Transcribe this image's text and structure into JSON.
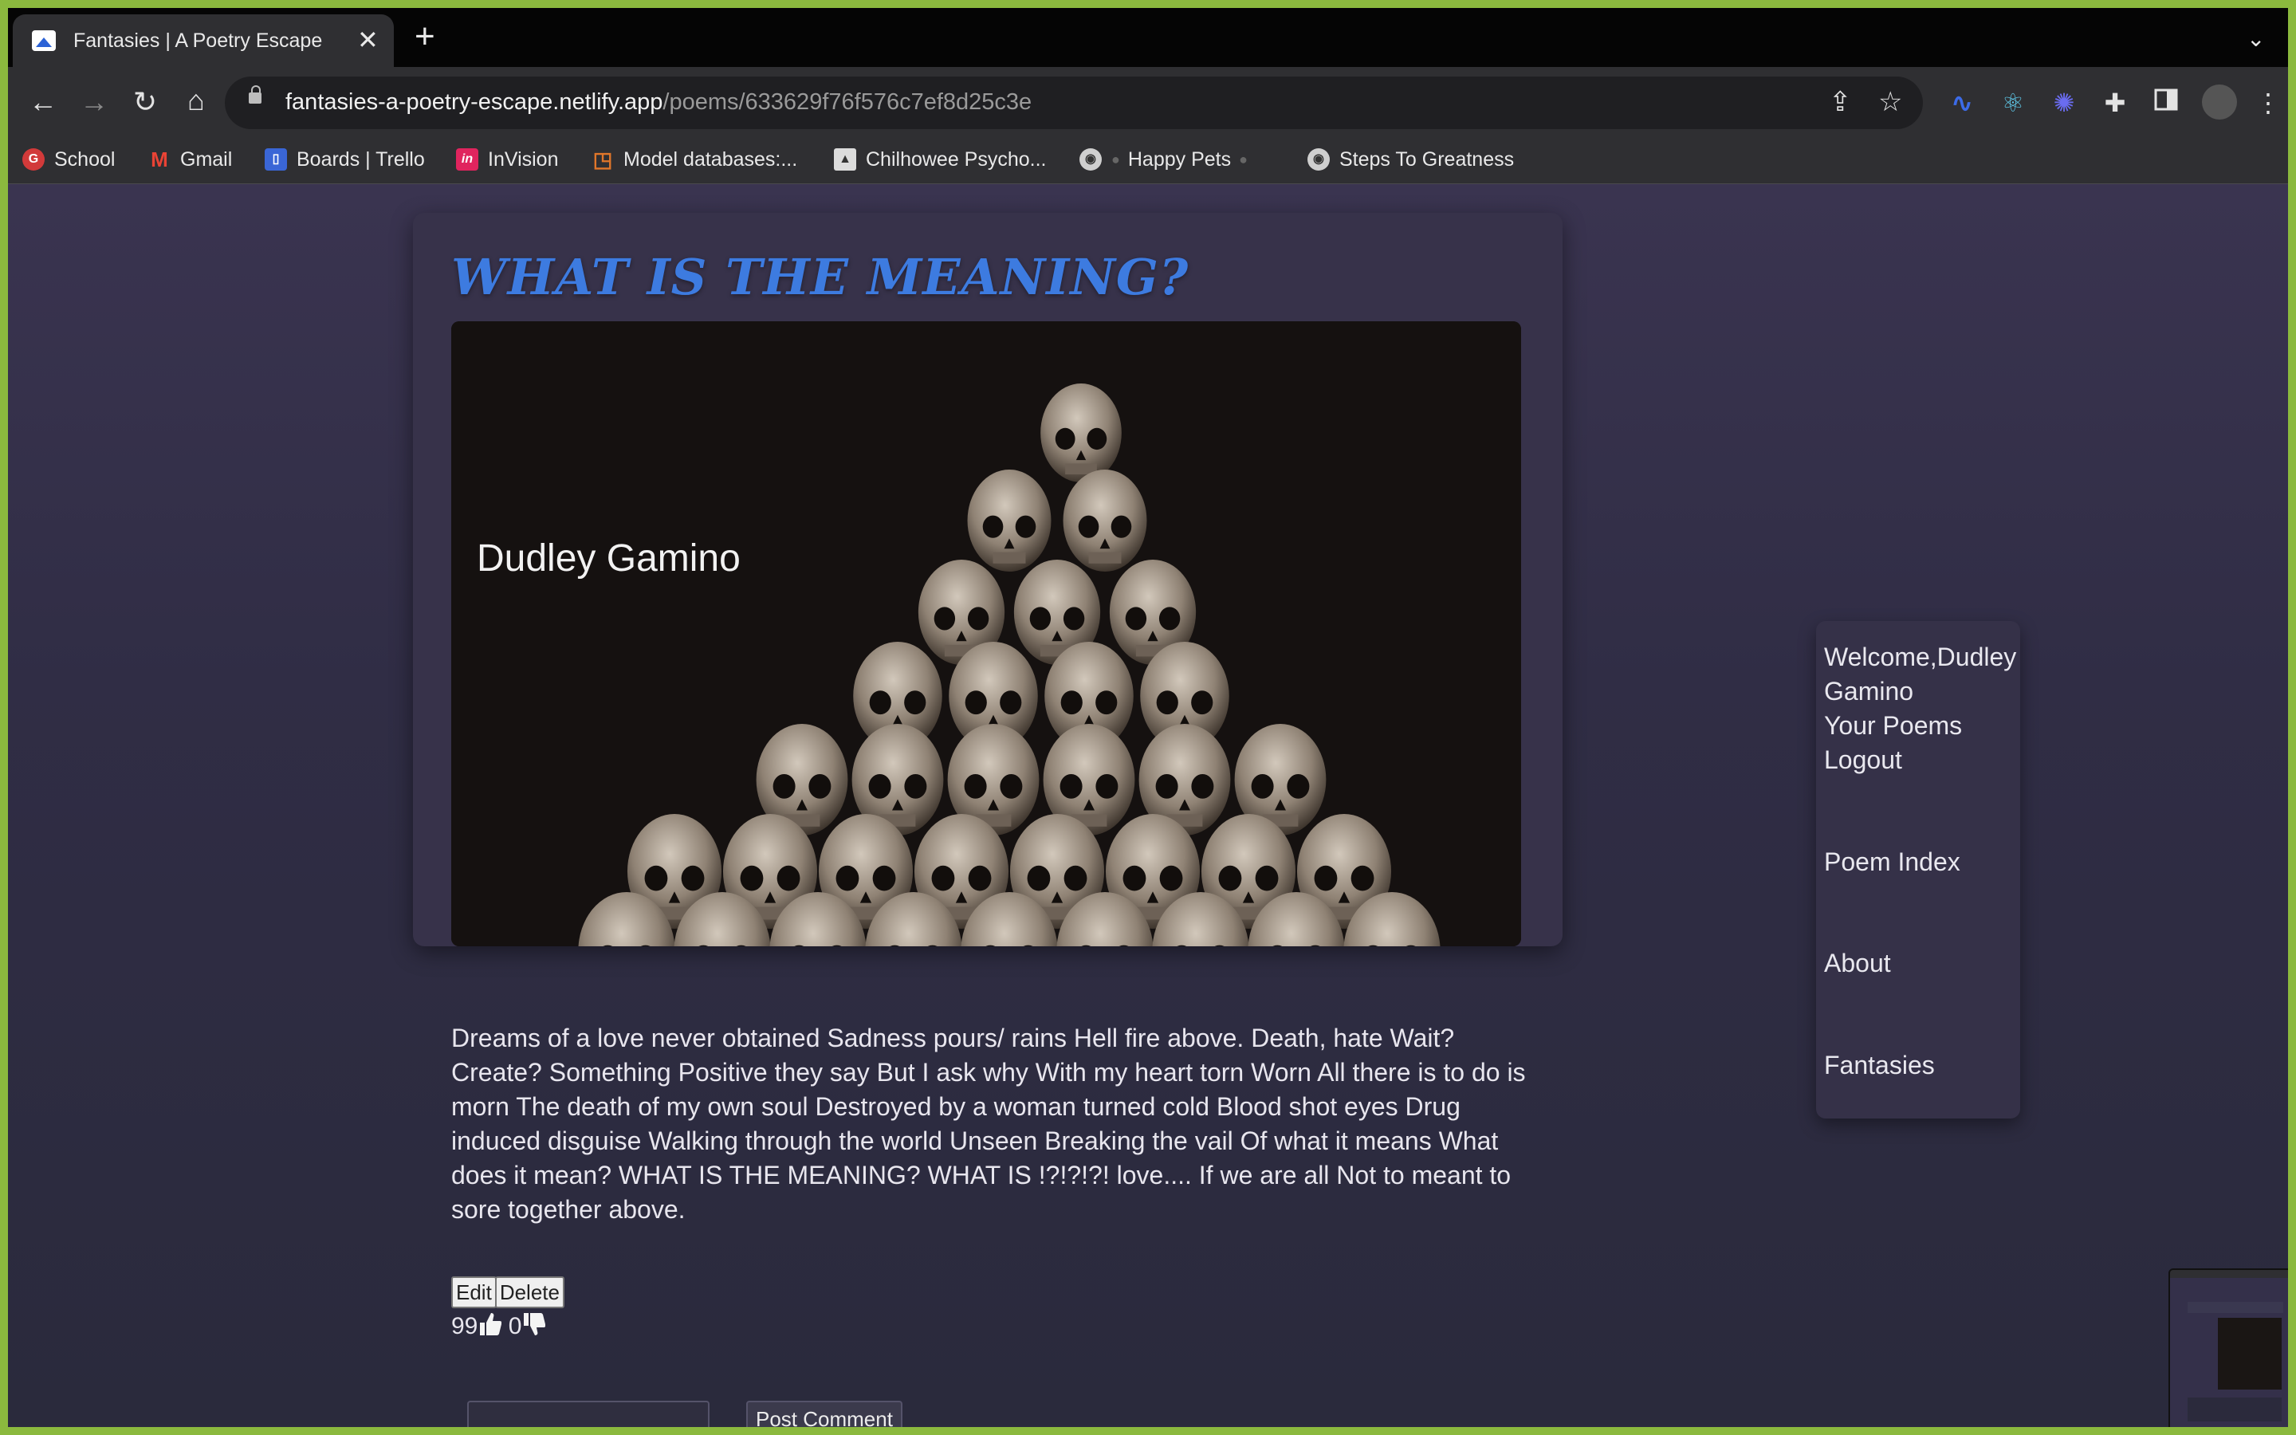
{
  "browser": {
    "tab_title": "Fantasies | A Poetry Escape",
    "url_host": "fantasies-a-poetry-escape.netlify.app",
    "url_path": "/poems/633629f76f576c7ef8d25c3e",
    "bookmarks": [
      {
        "label": "School",
        "icon": "ga-icon",
        "color": "#d23a3a"
      },
      {
        "label": "Gmail",
        "icon": "gmail-icon",
        "color": "#ea4335"
      },
      {
        "label": "Boards | Trello",
        "icon": "trello-icon",
        "color": "#3a66d6"
      },
      {
        "label": "InVision",
        "icon": "invision-icon",
        "color": "#e0245e"
      },
      {
        "label": "Model databases:...",
        "icon": "model-icon",
        "color": "#e0762a"
      },
      {
        "label": "Chilhowee Psycho...",
        "icon": "chilhowee-icon",
        "color": "#bdbdbd"
      },
      {
        "label": "Happy Pets",
        "icon": "globe-icon",
        "color": "#cfcfcf"
      },
      {
        "label": "Steps To Greatness",
        "icon": "globe-icon",
        "color": "#cfcfcf"
      }
    ]
  },
  "poem": {
    "title": "WHAT IS THE MEANING?",
    "author": "Dudley Gamino",
    "body": "Dreams of a love never obtained Sadness pours/ rains Hell fire above. Death, hate Wait? Create? Something Positive they say But I ask why With my heart torn Worn All there is to do is morn The death of my own soul Destroyed by a woman turned cold Blood shot eyes Drug induced disguise Walking through the world Unseen Breaking the vail Of what it means What does it mean? WHAT IS THE MEANING? WHAT IS !?!?!?! love.... If we are all Not to meant to sore together above.",
    "edit_label": "Edit",
    "delete_label": "Delete",
    "likes": "99",
    "dislikes": "0",
    "post_comment_label": "Post Comment"
  },
  "menu": {
    "welcome": "Welcome,Dudley",
    "welcome_name": "Gamino",
    "your_poems": "Your Poems",
    "logout": "Logout",
    "poem_index": "Poem Index",
    "about": "About",
    "fantasies": "Fantasies"
  },
  "colors": {
    "title_blue": "#3d7be0",
    "page_bg": "#302d45",
    "frame_green": "#8bb93e"
  }
}
